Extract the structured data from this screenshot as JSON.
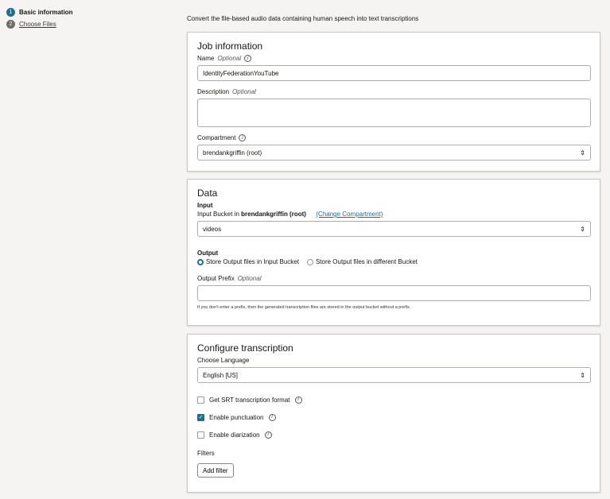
{
  "steps": [
    {
      "num": "1",
      "label": "Basic information"
    },
    {
      "num": "2",
      "label": "Choose Files"
    }
  ],
  "intro": "Convert the file-based audio data containing human speech into text transcriptions",
  "job": {
    "title": "Job information",
    "name_label": "Name",
    "optional": "Optional",
    "name_value": "IdentityFederationYouTube",
    "desc_label": "Description",
    "compartment_label": "Compartment",
    "compartment_value": "brendankgriffin (root)"
  },
  "data": {
    "title": "Data",
    "input_heading": "Input",
    "bucket_prefix": "Input Bucket in ",
    "bucket_compartment": "brendankgriffin (root)",
    "change_link": "(Change Compartment)",
    "bucket_value": "videos",
    "output_heading": "Output",
    "radio1": "Store Output files in Input Bucket",
    "radio2": "Store Output files in different Bucket",
    "prefix_label": "Output Prefix",
    "help": "If you don't enter a prefix, then the generated transcription files are stored in the output bucket without a prefix."
  },
  "transcription": {
    "title": "Configure transcription",
    "lang_label": "Choose Language",
    "lang_value": "English [US]",
    "srt": "Get SRT transcription format",
    "srt_checked": false,
    "punct": "Enable punctuation",
    "punct_checked": true,
    "diar": "Enable diarization",
    "diar_checked": false,
    "filters": "Filters",
    "add_filter": "Add filter"
  },
  "colors": {
    "accent": "#1f6e8c"
  }
}
